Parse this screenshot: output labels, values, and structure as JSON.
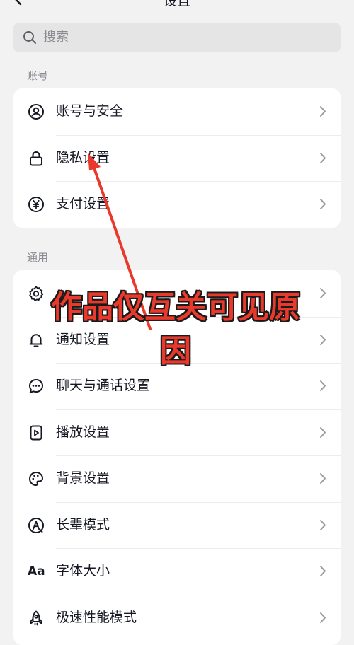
{
  "header": {
    "title": "设置"
  },
  "search": {
    "placeholder": "搜索"
  },
  "sections": {
    "account": {
      "label": "账号",
      "items": [
        {
          "label": "账号与安全",
          "icon": "user-circle-icon"
        },
        {
          "label": "隐私设置",
          "icon": "lock-icon"
        },
        {
          "label": "支付设置",
          "icon": "yen-circle-icon"
        }
      ]
    },
    "general": {
      "label": "通用",
      "items": [
        {
          "label": "",
          "icon": "gear-icon"
        },
        {
          "label": "通知设置",
          "icon": "bell-icon"
        },
        {
          "label": "聊天与通话设置",
          "icon": "chat-bubble-icon"
        },
        {
          "label": "播放设置",
          "icon": "play-icon"
        },
        {
          "label": "背景设置",
          "icon": "palette-icon"
        },
        {
          "label": "长辈模式",
          "icon": "elder-mode-icon"
        },
        {
          "label": "字体大小",
          "icon": "font-size-icon",
          "icon_text": "Aa"
        },
        {
          "label": "极速性能模式",
          "icon": "rocket-icon"
        }
      ]
    }
  },
  "annotation": {
    "line1": "作品仅互关可见原",
    "line2": "因",
    "color": "#e8392c"
  }
}
